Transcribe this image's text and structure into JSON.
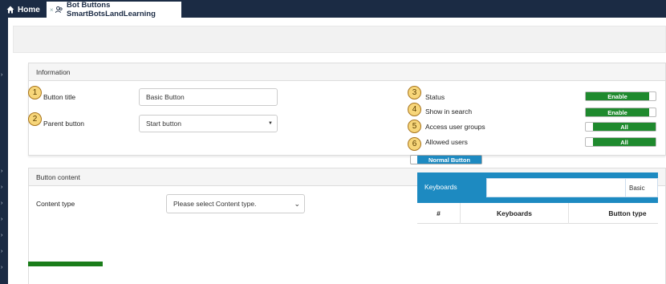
{
  "tabs": {
    "home": "Home",
    "active": "Bot Buttons SmartBotsLandLearning",
    "active_close": "×"
  },
  "info_card": {
    "header": "Information",
    "button_title": {
      "badge": "1",
      "label": "Button title",
      "value": "Basic Button"
    },
    "parent_button": {
      "badge": "2",
      "label": "Parent button",
      "value": "Start button"
    },
    "status": {
      "badge": "3",
      "label": "Status",
      "value": "Enable"
    },
    "show_in_search": {
      "badge": "4",
      "label": "Show in search",
      "value": "Enable"
    },
    "access_user_groups": {
      "badge": "5",
      "label": "Access user groups",
      "value": "All"
    },
    "allowed_users": {
      "badge": "6",
      "label": "Allowed users",
      "value": "All"
    }
  },
  "content_card": {
    "header": "Button content",
    "content_type_label": "Content type",
    "content_type_value": "Please select Content type.",
    "button_mode": "Normal Button",
    "keyboards_title": "Keyboards",
    "keyboard_type_value": "Basic",
    "columns": [
      "#",
      "Keyboards",
      "Button type"
    ]
  },
  "colors": {
    "nav": "#1b2b44",
    "enable_green": "#1f8a2e",
    "accent_blue": "#1d8ac1",
    "badge_fill": "#f7d67a"
  }
}
